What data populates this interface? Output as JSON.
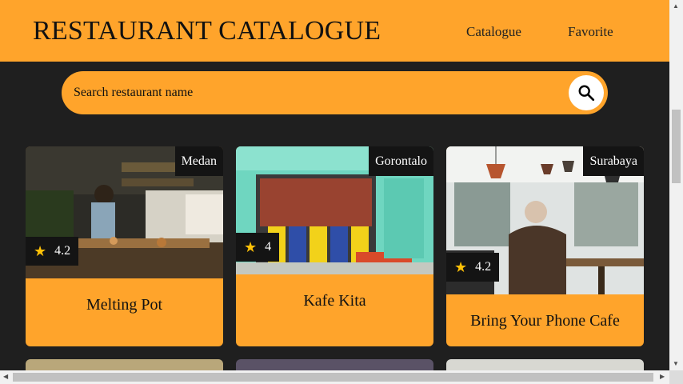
{
  "header": {
    "brand": "RESTAURANT CATALOGUE",
    "nav": [
      {
        "label": "Catalogue"
      },
      {
        "label": "Favorite"
      }
    ]
  },
  "search": {
    "placeholder": "Search restaurant name",
    "icon": "search-icon"
  },
  "colors": {
    "accent": "#ffa42b",
    "background": "#1f1f1f",
    "overlay": "#141414",
    "star": "#ffc107"
  },
  "restaurants": [
    {
      "name": "Melting Pot",
      "city": "Medan",
      "rating": "4.2"
    },
    {
      "name": "Kafe Kita",
      "city": "Gorontalo",
      "rating": "4"
    },
    {
      "name": "Bring Your Phone Cafe",
      "city": "Surabaya",
      "rating": "4.2"
    }
  ]
}
